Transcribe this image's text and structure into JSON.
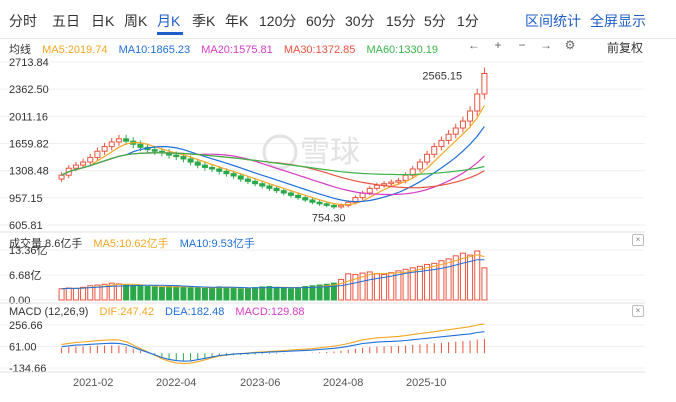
{
  "tabs": [
    {
      "label": "分时",
      "active": false
    },
    {
      "label": "五日",
      "active": false
    },
    {
      "label": "日K",
      "active": false
    },
    {
      "label": "周K",
      "active": false
    },
    {
      "label": "月K",
      "active": true
    },
    {
      "label": "季K",
      "active": false
    },
    {
      "label": "年K",
      "active": false
    },
    {
      "label": "120分",
      "active": false
    },
    {
      "label": "60分",
      "active": false
    },
    {
      "label": "30分",
      "active": false
    },
    {
      "label": "15分",
      "active": false
    },
    {
      "label": "5分",
      "active": false
    },
    {
      "label": "1分",
      "active": false
    }
  ],
  "top_actions": {
    "interval_stats": "区间统计",
    "fullscreen": "全屏显示"
  },
  "toolbar": {
    "fq_label": "前复权",
    "icons": [
      "move-left-icon",
      "zoom-in-icon",
      "zoom-out-icon",
      "move-right-icon",
      "settings-icon"
    ]
  },
  "main_legend": {
    "title": "均线",
    "items": [
      {
        "label": "MA5:2019.74",
        "color": "#f5a623"
      },
      {
        "label": "MA10:1865.23",
        "color": "#1e6fd9"
      },
      {
        "label": "MA20:1575.81",
        "color": "#d63cc6"
      },
      {
        "label": "MA30:1372.85",
        "color": "#e8533f"
      },
      {
        "label": "MA60:1330.19",
        "color": "#39b54a"
      }
    ]
  },
  "main_axis": [
    "2713.84",
    "2362.50",
    "2011.16",
    "1659.82",
    "1308.48",
    "957.15",
    "605.81"
  ],
  "annotations": {
    "high": "2565.15",
    "low": "754.30"
  },
  "volume_legend": {
    "title": "成交量 8.6亿手",
    "items": [
      {
        "label": "MA5:10.62亿手",
        "color": "#f5a623"
      },
      {
        "label": "MA10:9.53亿手",
        "color": "#1e6fd9"
      }
    ]
  },
  "volume_axis": [
    "13.36亿",
    "6.68亿",
    "0.00"
  ],
  "macd_legend": {
    "title": "MACD (12,26,9)",
    "items": [
      {
        "label": "DIF:247.42",
        "color": "#f5a623"
      },
      {
        "label": "DEA:182.48",
        "color": "#1e6fd9"
      },
      {
        "label": "MACD:129.88",
        "color": "#d63cc6"
      }
    ]
  },
  "macd_axis": [
    "256.66",
    "61.00",
    "-134.66"
  ],
  "x_axis": [
    "2021-02",
    "2022-04",
    "2023-06",
    "2024-08",
    "2025-10"
  ],
  "colors": {
    "up": "#e8533f",
    "down": "#2ba84a",
    "accent": "#1e5ec8"
  },
  "watermark": "雪球",
  "chart_data": {
    "type": "candlestick",
    "price_range": [
      605.81,
      2713.84
    ],
    "volume_range": [
      0,
      13.36
    ],
    "macd_range": [
      -134.66,
      256.66
    ],
    "x_ticks": [
      "2021-02",
      "2022-04",
      "2023-06",
      "2024-08",
      "2025-10"
    ],
    "close": [
      1250,
      1340,
      1380,
      1420,
      1480,
      1560,
      1620,
      1680,
      1720,
      1690,
      1650,
      1610,
      1580,
      1560,
      1540,
      1510,
      1490,
      1460,
      1420,
      1380,
      1350,
      1330,
      1300,
      1270,
      1240,
      1200,
      1170,
      1140,
      1110,
      1080,
      1050,
      1020,
      990,
      960,
      930,
      900,
      880,
      860,
      840,
      860,
      900,
      960,
      1020,
      1080,
      1120,
      1140,
      1160,
      1180,
      1250,
      1330,
      1420,
      1520,
      1620,
      1700,
      1780,
      1860,
      1950,
      2080,
      2300,
      2565
    ],
    "volume": [
      3.0,
      3.2,
      3.1,
      3.4,
      3.8,
      4.0,
      4.2,
      4.5,
      4.3,
      4.1,
      3.9,
      3.7,
      3.6,
      3.5,
      3.4,
      3.6,
      3.8,
      3.5,
      3.3,
      3.2,
      3.1,
      3.3,
      3.5,
      3.4,
      3.2,
      3.0,
      3.1,
      3.3,
      3.5,
      3.6,
      3.4,
      3.2,
      3.0,
      3.3,
      3.6,
      3.8,
      4.0,
      4.2,
      4.5,
      5.5,
      7.0,
      6.8,
      7.2,
      7.5,
      7.0,
      6.8,
      7.3,
      7.8,
      8.2,
      8.6,
      9.0,
      9.5,
      9.8,
      10.5,
      11.0,
      11.8,
      12.5,
      12.0,
      13.1,
      8.6
    ],
    "macd_hist": [
      50,
      55,
      60,
      62,
      65,
      68,
      70,
      72,
      70,
      60,
      40,
      20,
      0,
      -20,
      -40,
      -55,
      -65,
      -70,
      -68,
      -60,
      -50,
      -40,
      -30,
      -25,
      -20,
      -18,
      -15,
      -12,
      -10,
      -8,
      -6,
      -4,
      -2,
      0,
      2,
      4,
      8,
      12,
      16,
      22,
      30,
      40,
      50,
      55,
      60,
      62,
      64,
      66,
      70,
      75,
      80,
      85,
      90,
      95,
      100,
      105,
      110,
      115,
      125,
      130
    ]
  }
}
